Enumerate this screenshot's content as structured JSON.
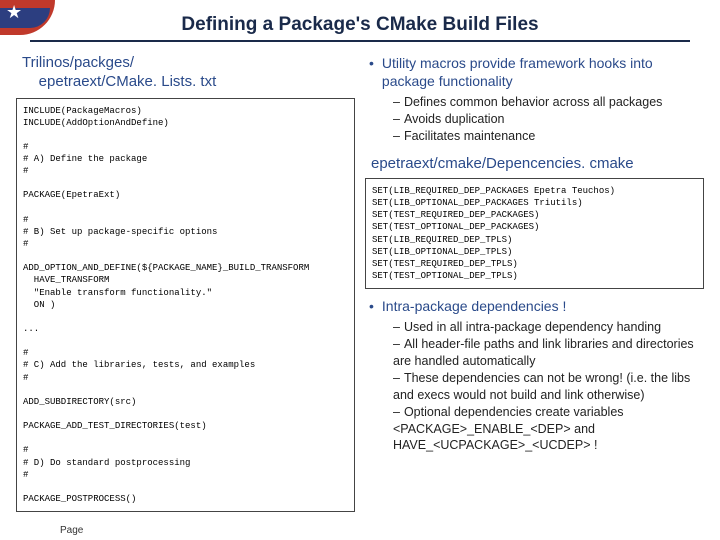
{
  "title": "Defining a Package's CMake Build Files",
  "leftPath": "Trilinos/packges/\n    epetraext/CMake. Lists. txt",
  "code1": "INCLUDE(PackageMacros)\nINCLUDE(AddOptionAndDefine)\n\n#\n# A) Define the package\n#\n\nPACKAGE(EpetraExt)\n\n#\n# B) Set up package-specific options\n#\n\nADD_OPTION_AND_DEFINE(${PACKAGE_NAME}_BUILD_TRANSFORM\n  HAVE_TRANSFORM\n  \"Enable transform functionality.\"\n  ON )\n\n...\n\n#\n# C) Add the libraries, tests, and examples\n#\n\nADD_SUBDIRECTORY(src)\n\nPACKAGE_ADD_TEST_DIRECTORIES(test)\n\n#\n# D) Do standard postprocessing\n#\n\nPACKAGE_POSTPROCESS()",
  "bullet1": "Utility macros provide framework hooks into package functionality",
  "sub1a": "Defines common behavior across all packages",
  "sub1b": "Avoids duplication",
  "sub1c": "Facilitates maintenance",
  "midhead": "epetraext/cmake/Depencencies. cmake",
  "code2": "SET(LIB_REQUIRED_DEP_PACKAGES Epetra Teuchos)\nSET(LIB_OPTIONAL_DEP_PACKAGES Triutils)\nSET(TEST_REQUIRED_DEP_PACKAGES)\nSET(TEST_OPTIONAL_DEP_PACKAGES)\nSET(LIB_REQUIRED_DEP_TPLS)\nSET(LIB_OPTIONAL_DEP_TPLS)\nSET(TEST_REQUIRED_DEP_TPLS)\nSET(TEST_OPTIONAL_DEP_TPLS)",
  "bullet2": "Intra-package dependencies !",
  "sub2a": "Used in all intra-package dependency handing",
  "sub2b": "All header-file paths and link libraries and directories are handled automatically",
  "sub2c": "These dependencies can not be wrong! (i.e. the libs and execs would not build and link otherwise)",
  "sub2d": "Optional dependencies create variables <PACKAGE>_ENABLE_<DEP> and HAVE_<UCPACKAGE>_<UCDEP> !",
  "footer": "Page"
}
